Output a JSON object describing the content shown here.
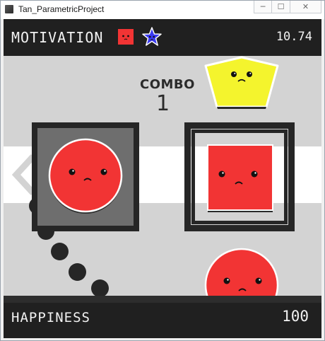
{
  "window": {
    "title": "Tan_ParametricProject",
    "controls": {
      "minimize": "─",
      "maximize": "☐",
      "close": "✕"
    }
  },
  "hud": {
    "motivation_label": "MOTIVATION",
    "motivation_value": "10.74",
    "happiness_label": "HAPPINESS",
    "happiness_value": "100",
    "combo_label": "COMBO",
    "combo_value": "1"
  },
  "colors": {
    "bar": "#202020",
    "playfield": "#d3d3d3",
    "lane": "#ffffff",
    "red_shape": "#f23434",
    "yellow_shape": "#f4f42d",
    "blue_shape": "#3a3af2",
    "frame": "#262626"
  },
  "icons": {
    "motivation_square": "sad-red-square-icon",
    "motivation_star": "sad-blue-star-icon",
    "lane_arrow": "left-chevron-icon"
  }
}
